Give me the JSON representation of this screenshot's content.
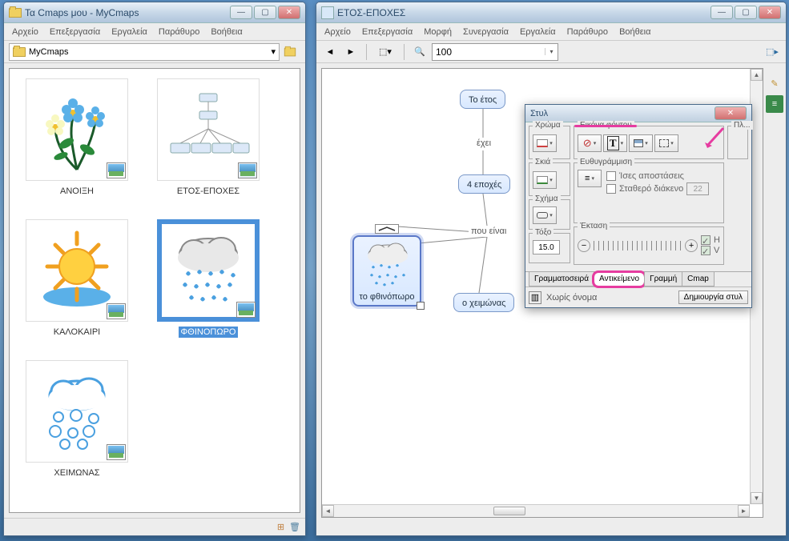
{
  "leftWindow": {
    "title": "Τα Cmaps μου - MyCmaps",
    "menu": [
      "Αρχείο",
      "Επεξεργασία",
      "Εργαλεία",
      "Παράθυρο",
      "Βοήθεια"
    ],
    "path": "MyCmaps",
    "thumbs": [
      {
        "label": "ΑΝΟΙΞΗ"
      },
      {
        "label": "ΕΤΟΣ-ΕΠΟΧΕΣ"
      },
      {
        "label": "ΚΑΛΟΚΑΙΡΙ"
      },
      {
        "label": "ΦΘΙΝΟΠΩΡΟ",
        "selected": true
      },
      {
        "label": "ΧΕΙΜΩΝΑΣ"
      }
    ]
  },
  "rightWindow": {
    "title": "ΕΤΟΣ-ΕΠΟΧΕΣ",
    "menu": [
      "Αρχείο",
      "Επεξεργασία",
      "Μορφή",
      "Συνεργασία",
      "Εργαλεία",
      "Παράθυρο",
      "Βοήθεια"
    ],
    "zoom": "100",
    "nodes": {
      "root": "Το έτος",
      "link1": "έχει",
      "mid": "4 εποχές",
      "link2": "που είναι",
      "autumn": "το φθινόπωρο",
      "winter": "ο χειμώνας"
    }
  },
  "stylePanel": {
    "title": "Στυλ",
    "groups": {
      "color": "Χρώμα",
      "shadow": "Σκιά",
      "shape": "Σχήμα",
      "arc": "Τόξο",
      "arcValue": "15.0",
      "bgImage": "Εικόνα φόντου",
      "align": "Ευθυγράμμιση",
      "equalDist": "Ίσες αποστάσεις",
      "fixedGap": "Σταθερό διάκενο",
      "fixedGapValue": "22",
      "extent": "Έκταση",
      "h": "H",
      "v": "V",
      "pl": "Πλ..."
    },
    "tabs": [
      "Γραμματοσειρά",
      "Αντικείμενο",
      "Γραμμή",
      "Cmap"
    ],
    "activeTab": 1,
    "footer": {
      "noname": "Χωρίς όνομα",
      "create": "Δημιουργία στυλ"
    }
  }
}
